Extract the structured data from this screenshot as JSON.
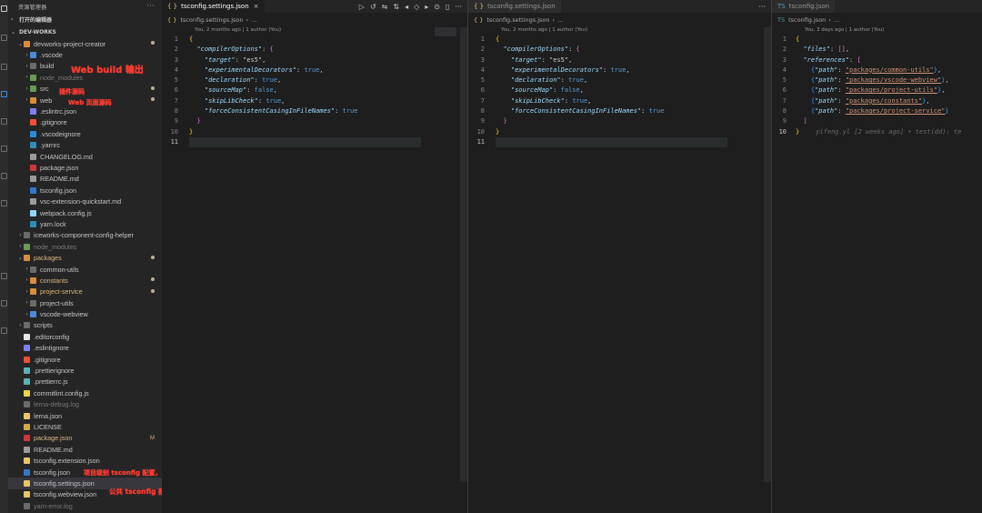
{
  "sidebar": {
    "title": "资源管理器",
    "open_editors": "打开的编辑器",
    "workspace": "DEV-WORKS",
    "tree": [
      {
        "depth": 1,
        "chev": "v",
        "icon": "folder-orange",
        "label": "devworks-project-creator",
        "badge": "dot"
      },
      {
        "depth": 2,
        "chev": ">",
        "icon": "folder-blue",
        "label": ".vscode"
      },
      {
        "depth": 2,
        "chev": ">",
        "icon": "folder-gray",
        "label": "build"
      },
      {
        "depth": 2,
        "chev": ">",
        "icon": "folder-green",
        "label": "node_modules",
        "dim": true
      },
      {
        "depth": 2,
        "chev": ">",
        "icon": "folder-green",
        "label": "src",
        "badge": "dot"
      },
      {
        "depth": 2,
        "chev": ">",
        "icon": "folder-orange",
        "label": "web",
        "badge": "dot"
      },
      {
        "depth": 2,
        "chev": "",
        "icon": "eslint",
        "label": ".eslintrc.json"
      },
      {
        "depth": 2,
        "chev": "",
        "icon": "git",
        "label": ".gitignore"
      },
      {
        "depth": 2,
        "chev": "",
        "icon": "vscode",
        "label": ".vscodeignore"
      },
      {
        "depth": 2,
        "chev": "",
        "icon": "yarn",
        "label": ".yarnrc"
      },
      {
        "depth": 2,
        "chev": "",
        "icon": "md",
        "label": "CHANGELOG.md"
      },
      {
        "depth": 2,
        "chev": "",
        "icon": "npm",
        "label": "package.json"
      },
      {
        "depth": 2,
        "chev": "",
        "icon": "md",
        "label": "README.md"
      },
      {
        "depth": 2,
        "chev": "",
        "icon": "ts",
        "label": "tsconfig.json"
      },
      {
        "depth": 2,
        "chev": "",
        "icon": "md",
        "label": "vsc-extension-quickstart.md"
      },
      {
        "depth": 2,
        "chev": "",
        "icon": "webpack",
        "label": "webpack.config.js"
      },
      {
        "depth": 2,
        "chev": "",
        "icon": "yarn",
        "label": "yarn.lock"
      },
      {
        "depth": 1,
        "chev": ">",
        "icon": "folder-gray",
        "label": "iceworks-component-config-helper"
      },
      {
        "depth": 1,
        "chev": ">",
        "icon": "folder-green",
        "label": "node_modules",
        "dim": true
      },
      {
        "depth": 1,
        "chev": "v",
        "icon": "folder-orange",
        "label": "packages",
        "badge": "dot",
        "orange": true
      },
      {
        "depth": 2,
        "chev": ">",
        "icon": "folder-gray",
        "label": "common-utils"
      },
      {
        "depth": 2,
        "chev": ">",
        "icon": "folder-orange",
        "label": "constants",
        "badge": "dot",
        "orange": true
      },
      {
        "depth": 2,
        "chev": ">",
        "icon": "folder-orange",
        "label": "project-service",
        "badge": "dot",
        "orange": true
      },
      {
        "depth": 2,
        "chev": ">",
        "icon": "folder-gray",
        "label": "project-utils"
      },
      {
        "depth": 2,
        "chev": ">",
        "icon": "folder-blue",
        "label": "vscode-webview"
      },
      {
        "depth": 1,
        "chev": ">",
        "icon": "folder-gray",
        "label": "scripts"
      },
      {
        "depth": 1,
        "chev": "",
        "icon": "editorconfig",
        "label": ".editorconfig"
      },
      {
        "depth": 1,
        "chev": "",
        "icon": "eslint",
        "label": ".eslintignore"
      },
      {
        "depth": 1,
        "chev": "",
        "icon": "git",
        "label": ".gitignore"
      },
      {
        "depth": 1,
        "chev": "",
        "icon": "prettier",
        "label": ".prettierignore"
      },
      {
        "depth": 1,
        "chev": "",
        "icon": "prettier",
        "label": ".prettierrc.js"
      },
      {
        "depth": 1,
        "chev": "",
        "icon": "js",
        "label": "commitlint.config.js"
      },
      {
        "depth": 1,
        "chev": "",
        "icon": "log",
        "label": "lerna-debug.log",
        "dim": true
      },
      {
        "depth": 1,
        "chev": "",
        "icon": "json",
        "label": "lerna.json"
      },
      {
        "depth": 1,
        "chev": "",
        "icon": "license",
        "label": "LICENSE"
      },
      {
        "depth": 1,
        "chev": "",
        "icon": "npm",
        "label": "package.json",
        "badge": "M",
        "orange": true
      },
      {
        "depth": 1,
        "chev": "",
        "icon": "md",
        "label": "README.md"
      },
      {
        "depth": 1,
        "chev": "",
        "icon": "json",
        "label": "tsconfig.extension.json"
      },
      {
        "depth": 1,
        "chev": "",
        "icon": "ts",
        "label": "tsconfig.json"
      },
      {
        "depth": 1,
        "chev": "",
        "icon": "json",
        "label": "tsconfig.settings.json",
        "selected": true
      },
      {
        "depth": 1,
        "chev": "",
        "icon": "json",
        "label": "tsconfig.webview.json"
      },
      {
        "depth": 1,
        "chev": "",
        "icon": "log",
        "label": "yarn-error.log",
        "dim": true
      }
    ]
  },
  "annotations": {
    "web_build": "Web  build  输出",
    "plugin_src": "插件源码",
    "web_src": "Web 页面源码",
    "project_tsconfig": "项目级别 tsconfig 配置，主要是 references",
    "shared_tsconfig": "公共 tsconfig 配置"
  },
  "editors": [
    {
      "tab": "tsconfig.settings.json",
      "tab_close": "×",
      "crumb": "tsconfig.settings.json",
      "crumb_more": "…",
      "lens": "You, 2 months ago | 1 author (You)"
    },
    {
      "tab": "tsconfig.settings.json",
      "crumb": "tsconfig.settings.json",
      "crumb_more": "…",
      "lens": "You, 2 months ago | 1 author (You)"
    },
    {
      "tab": "tsconfig.json",
      "crumb": "tsconfig.json",
      "crumb_more": "…",
      "lens": "You, 3 days ago | 1 author (You)"
    }
  ],
  "settings_code": [
    "{",
    "  \"compilerOptions\": {",
    "    \"target\": \"es5\",",
    "    \"experimentalDecorators\": true,",
    "    \"declaration\": true,",
    "    \"sourceMap\": false,",
    "    \"skipLibCheck\": true,",
    "    \"forceConsistentCasingInFileNames\": true",
    "  }",
    "}",
    ""
  ],
  "tsconfig_code": {
    "files_key": "\"files\"",
    "references_key": "\"references\"",
    "path_key": "\"path\"",
    "paths": [
      "\"packages/common-utils\"",
      "\"packages/vscode-webview\"",
      "\"packages/project-utils\"",
      "\"packages/constants\"",
      "\"packages/project-service\""
    ],
    "blame": "yifeng.yl [2 weeks ago] • test(dd): te"
  }
}
